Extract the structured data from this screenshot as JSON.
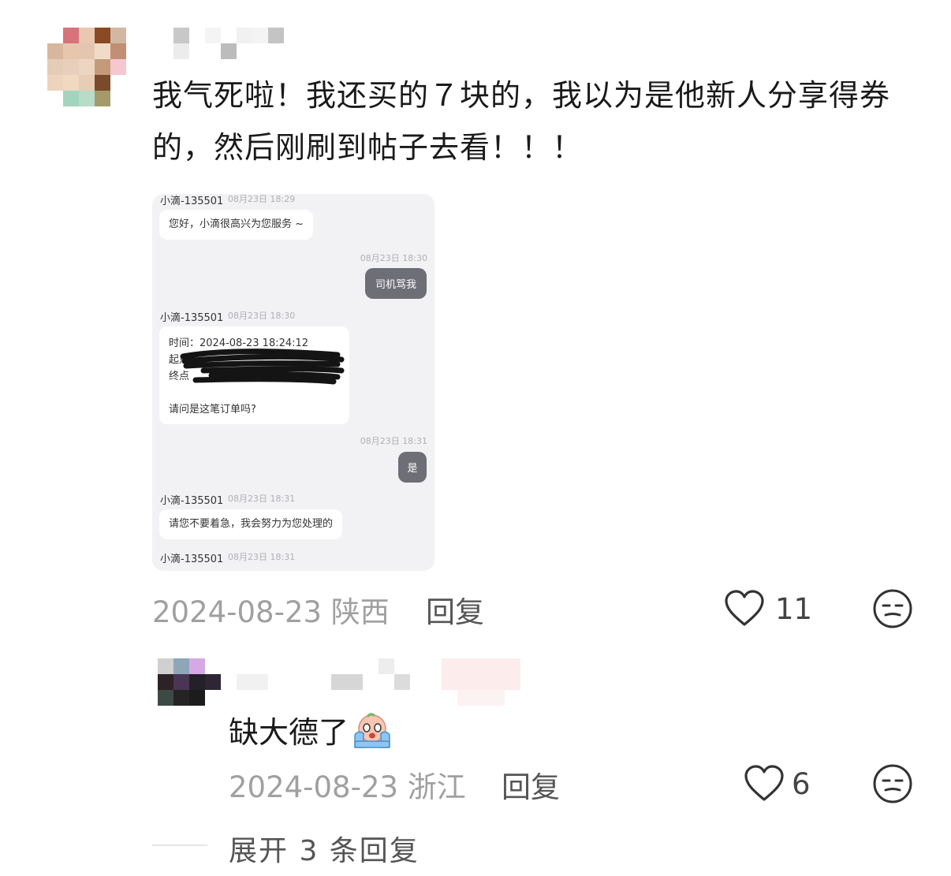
{
  "comment": {
    "text": "我气死啦！我还买的７块的，我以为是他新人分享得券的，然后刚刷到帖子去看！！！",
    "date_location": "2024-08-23 陕西",
    "reply_label": "回复",
    "like_count": "11"
  },
  "chat_screenshot": {
    "agent_name": "小滴-135501",
    "messages": [
      {
        "side": "left",
        "time": "08月23日 18:29",
        "text": "您好，小滴很高兴为您服务 ~"
      },
      {
        "side": "right",
        "time": "08月23日 18:30",
        "text": "司机骂我"
      },
      {
        "side": "left",
        "time": "08月23日 18:30",
        "lines": [
          "时间：2024-08-23 18:24:12",
          "起点",
          "终点",
          "",
          "请问是这笔订单吗?"
        ]
      },
      {
        "side": "right",
        "time": "08月23日 18:31",
        "text": "是"
      },
      {
        "side": "left",
        "time": "08月23日 18:31",
        "text": "请您不要着急，我会努力为您处理的"
      },
      {
        "side": "left",
        "time": "08月23日 18:31",
        "text": ""
      }
    ]
  },
  "sub_reply": {
    "text": "缺大德了",
    "date_location": "2024-08-23 浙江",
    "reply_label": "回复",
    "like_count": "6"
  },
  "expand_label": "展开 3 条回复",
  "icons": [
    "heart-icon",
    "meh-face-icon",
    "crying-emoji-icon"
  ],
  "colors": {
    "bubble_right": "#6e6e77",
    "chat_bg": "#f2f2f5",
    "meta_text": "#a0a0a0"
  }
}
